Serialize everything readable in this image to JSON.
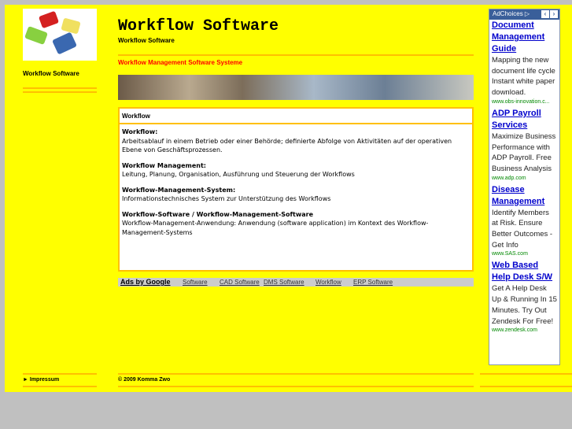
{
  "left": {
    "logo": "puzzle-logo",
    "title": "Workflow Software",
    "impressum": "Impressum"
  },
  "header": {
    "title": "Workflow Software",
    "subtitle": "Workflow Software",
    "tagline": "Workflow Management Software Systeme"
  },
  "content": {
    "heading": "Workflow",
    "entries": [
      {
        "term": "Workflow:",
        "def": "Arbeitsablauf in einem Betrieb oder einer Behörde; definierte Abfolge von Aktivitäten auf der operativen Ebene von Geschäftsprozessen."
      },
      {
        "term": "Workflow Management:",
        "def": "Leitung, Planung, Organisation, Ausführung und Steuerung der Workflows"
      },
      {
        "term": "Workflow-Management-System:",
        "def": "Informationstechnisches System zur Unterstützung des Workflows"
      },
      {
        "term": "Workflow-Software / Workflow-Management-Software",
        "def": "Workflow-Management-Anwendung: Anwendung (software application) im Kontext des Workflow-Management-Systems"
      }
    ]
  },
  "adsbar": {
    "label": "Ads by Google",
    "links": [
      "Software",
      "CAD Software",
      "DMS Software",
      "Workflow",
      "ERP Software"
    ]
  },
  "footer": {
    "copyright": "© 2009 Komma Zwo"
  },
  "ads": {
    "adchoices": "AdChoices",
    "items": [
      {
        "title": "Document Management Guide",
        "text": "Mapping the new document life cycle Instant white paper download.",
        "url": "www.obs-innovation.c..."
      },
      {
        "title": "ADP Payroll Services",
        "text": "Maximize Business Performance with ADP Payroll. Free Business Analysis",
        "url": "www.adp.com"
      },
      {
        "title": "Disease Management",
        "text": "Identify Members at Risk. Ensure Better Outcomes - Get Info",
        "url": "www.SAS.com"
      },
      {
        "title": "Web Based Help Desk S/W",
        "text": "Get A Help Desk Up & Running In 15 Minutes. Try Out Zendesk For Free!",
        "url": "www.zendesk.com"
      }
    ]
  }
}
